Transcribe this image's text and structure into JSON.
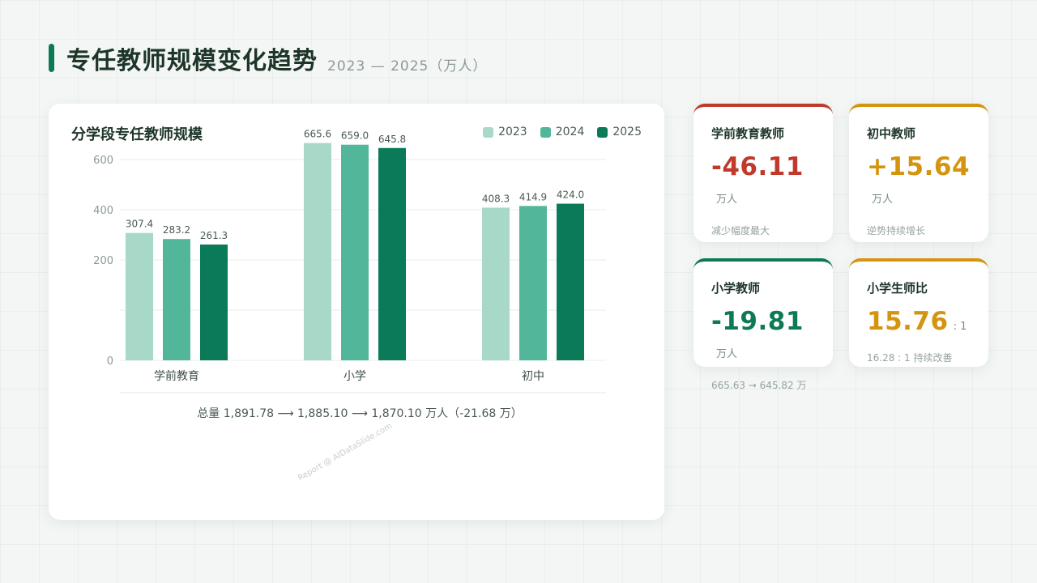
{
  "page": {
    "title": "专任教师规模变化趋势",
    "subtitle": "2023 — 2025（万人）"
  },
  "chart_card": {
    "title": "分学段专任教师规模",
    "watermark": "Report @ AIDataSlide.com"
  },
  "chart_data": {
    "type": "bar",
    "title": "分学段专任教师规模",
    "xlabel": "",
    "ylabel": "",
    "categories": [
      "学前教育",
      "小学",
      "初中"
    ],
    "series": [
      {
        "name": "2023",
        "color": "#a8d9c8",
        "values": [
          307.4,
          665.6,
          408.3
        ]
      },
      {
        "name": "2024",
        "color": "#52b69a",
        "values": [
          283.2,
          659.0,
          414.9
        ]
      },
      {
        "name": "2025",
        "color": "#0a7a58",
        "values": [
          261.3,
          645.8,
          424.0
        ]
      }
    ],
    "y_ticks": [
      0,
      200,
      400,
      600
    ],
    "grid": true,
    "legend": "top-right",
    "summary": "总量 1,891.78 ⟶ 1,885.10 ⟶ 1,870.10 万人（-21.68 万）"
  },
  "stats": [
    {
      "label": "学前教育教师",
      "value": "-46.11",
      "unit": "万人",
      "note": "减少幅度最大",
      "color": "#c0392b"
    },
    {
      "label": "初中教师",
      "value": "+15.64",
      "unit": "万人",
      "note": "逆势持续增长",
      "color": "#d4940f"
    },
    {
      "label": "小学教师",
      "value": "-19.81",
      "unit": "万人",
      "note": "665.63 → 645.82 万",
      "color": "#0d7a56"
    },
    {
      "label": "小学生师比",
      "value": "15.76",
      "unit": ": 1",
      "note": "16.28 : 1 持续改善",
      "color": "#d4940f"
    }
  ]
}
